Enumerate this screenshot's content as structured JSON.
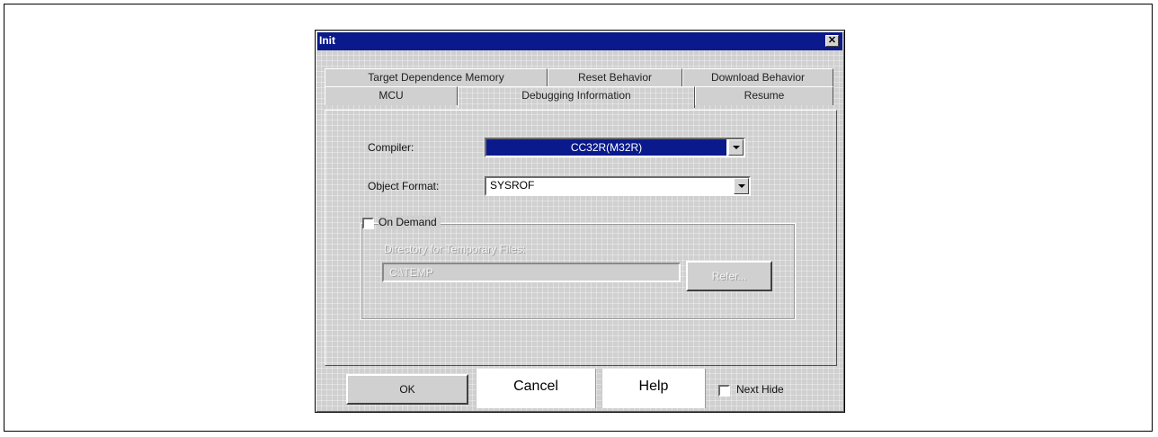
{
  "window": {
    "title": "Init",
    "close_glyph": "✕"
  },
  "tabs_row1": [
    {
      "label": "Target Dependence Memory"
    },
    {
      "label": "Reset Behavior"
    },
    {
      "label": "Download Behavior"
    }
  ],
  "tabs_row2": [
    {
      "label": "MCU"
    },
    {
      "label": "Debugging Information"
    },
    {
      "label": "Resume"
    }
  ],
  "active_tab": "Debugging Information",
  "form": {
    "compiler_label": "Compiler:",
    "compiler_value": "CC32R(M32R)",
    "object_format_label": "Object Format:",
    "object_format_value": "SYSROF",
    "on_demand_label": "On Demand",
    "on_demand_checked": false,
    "temp_dir_label": "Directory for Temporary Files:",
    "temp_dir_value": "C:\\TEMP",
    "refer_label": "Refer..."
  },
  "footer": {
    "ok_label": "OK",
    "cancel_label": "Cancel",
    "help_label": "Help",
    "next_hide_label": "Next Hide",
    "next_hide_checked": false
  },
  "colors": {
    "title_bar": "#0a1a8c",
    "dialog_face": "#d0d0d0",
    "selection": "#0a1a8c"
  },
  "icons": {
    "close": "close-icon",
    "dropdown": "chevron-down-icon"
  }
}
